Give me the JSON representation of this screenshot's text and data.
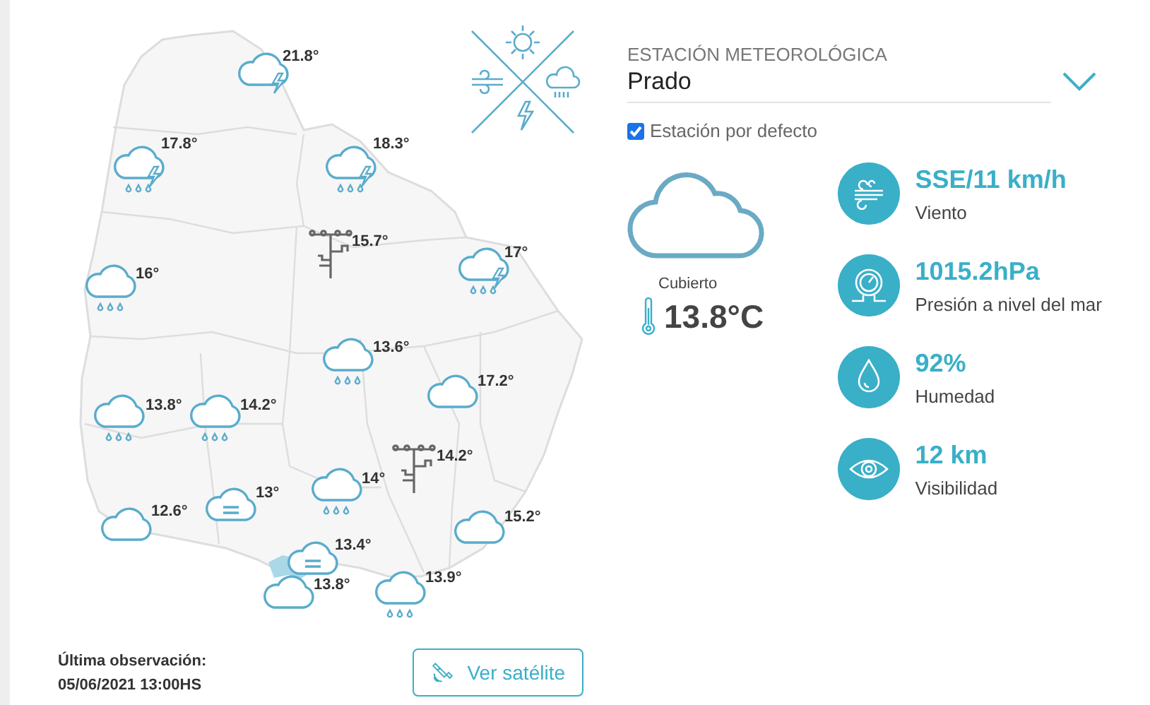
{
  "map": {
    "stations": [
      {
        "kind": "storm",
        "temp": "21.8°"
      },
      {
        "kind": "rain-storm",
        "temp": "17.8°"
      },
      {
        "kind": "rain-storm",
        "temp": "18.3°"
      },
      {
        "kind": "station",
        "temp": "15.7°"
      },
      {
        "kind": "rain-storm",
        "temp": "17°"
      },
      {
        "kind": "rain",
        "temp": "16°"
      },
      {
        "kind": "rain",
        "temp": "13.6°"
      },
      {
        "kind": "cloud",
        "temp": "17.2°"
      },
      {
        "kind": "rain",
        "temp": "13.8°"
      },
      {
        "kind": "rain",
        "temp": "14.2°"
      },
      {
        "kind": "station",
        "temp": "14.2°"
      },
      {
        "kind": "rain",
        "temp": "14°"
      },
      {
        "kind": "fog",
        "temp": "13°"
      },
      {
        "kind": "cloud",
        "temp": "12.6°"
      },
      {
        "kind": "cloud",
        "temp": "15.2°"
      },
      {
        "kind": "fog",
        "temp": "13.4°"
      },
      {
        "kind": "cloud",
        "temp": "13.8°"
      },
      {
        "kind": "rain",
        "temp": "13.9°"
      }
    ]
  },
  "observation": {
    "label": "Última observación:",
    "time": "05/06/2021 13:00HS"
  },
  "satellite_button": {
    "label": "Ver satélite"
  },
  "station_select": {
    "label": "ESTACIÓN METEOROLÓGICA",
    "value": "Prado"
  },
  "default_station": {
    "label": "Estación por defecto",
    "checked": true
  },
  "current": {
    "condition": "Cubierto",
    "temperature": "13.8°C"
  },
  "metrics": [
    {
      "kind": "wind",
      "value": "SSE/11 km/h",
      "label": "Viento"
    },
    {
      "kind": "pressure",
      "value": "1015.2hPa",
      "label": "Presión a nivel del mar"
    },
    {
      "kind": "humidity",
      "value": "92%",
      "label": "Humedad"
    },
    {
      "kind": "visibility",
      "value": "12 km",
      "label": "Visibilidad"
    }
  ]
}
